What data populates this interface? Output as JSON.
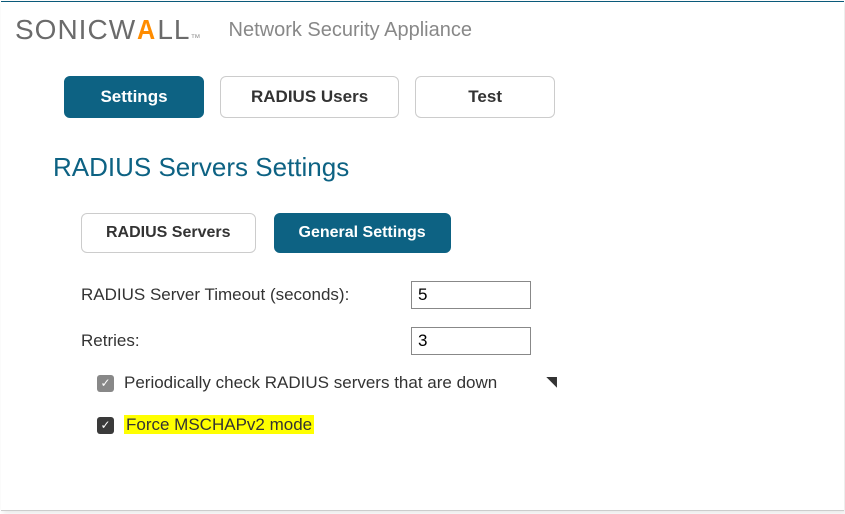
{
  "header": {
    "logo_sonic": "SONIC",
    "logo_wall_w": "W",
    "logo_wall_ll": "LL",
    "logo_tm": "™",
    "subtitle": "Network Security Appliance"
  },
  "tabs_primary": [
    {
      "label": "Settings",
      "active": true
    },
    {
      "label": "RADIUS Users",
      "active": false
    },
    {
      "label": "Test",
      "active": false
    }
  ],
  "section_title": "RADIUS Servers Settings",
  "tabs_secondary": [
    {
      "label": "RADIUS Servers",
      "active": false
    },
    {
      "label": "General Settings",
      "active": true
    }
  ],
  "form": {
    "timeout_label": "RADIUS Server Timeout (seconds):",
    "timeout_value": "5",
    "retries_label": "Retries:",
    "retries_value": "3"
  },
  "checks": {
    "periodic_label": "Periodically check RADIUS servers that are down",
    "force_label": "Force MSCHAPv2 mode"
  }
}
